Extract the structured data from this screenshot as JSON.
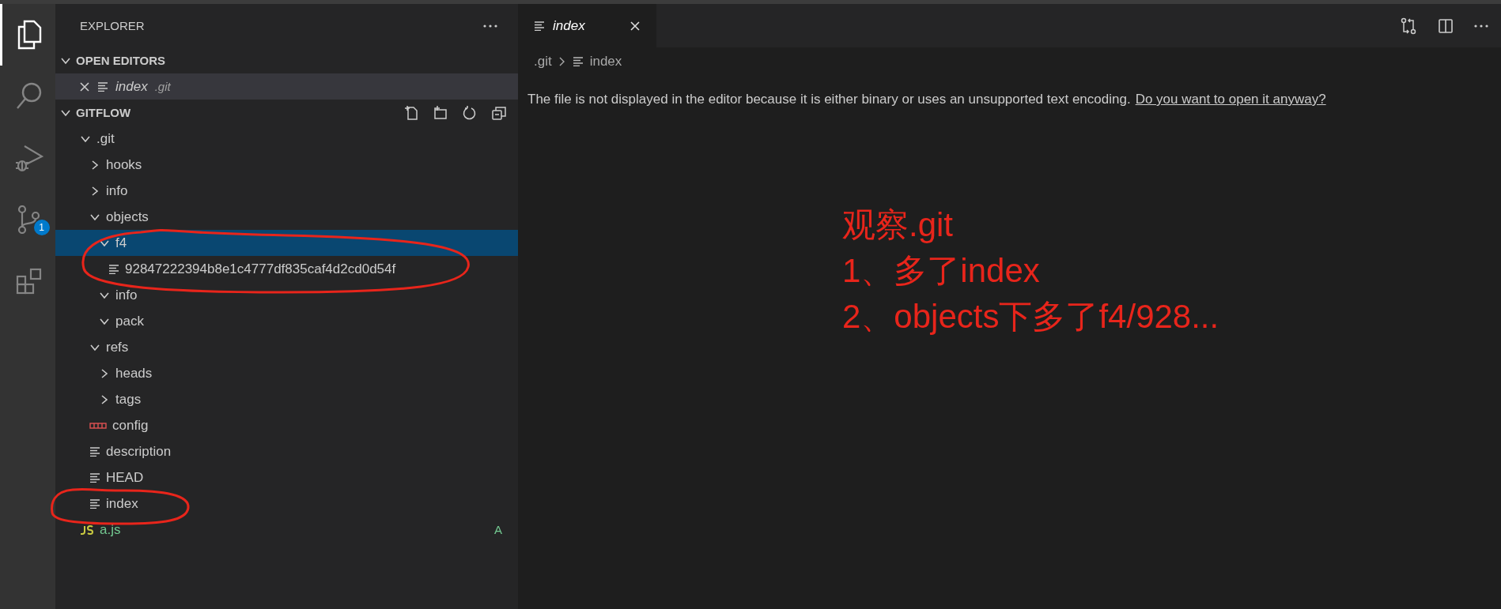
{
  "activity_bar": [
    {
      "kind": "explorer",
      "selected": true
    },
    {
      "kind": "search",
      "selected": false
    },
    {
      "kind": "debug",
      "selected": false
    },
    {
      "kind": "source_control",
      "selected": false,
      "badge": "1"
    },
    {
      "kind": "extensions",
      "selected": false
    }
  ],
  "sidebar": {
    "title": "EXPLORER",
    "open_editors": {
      "title": "OPEN EDITORS",
      "expanded": true,
      "items": [
        {
          "name": "index",
          "folder": ".git"
        }
      ]
    },
    "folder": {
      "title": "GITFLOW",
      "expanded": true,
      "tree": [
        {
          "name": ".git",
          "kind": "folder",
          "expanded": true,
          "selected": false,
          "children": [
            {
              "name": "hooks",
              "kind": "folder",
              "expanded": false,
              "selected": false
            },
            {
              "name": "info",
              "kind": "folder",
              "expanded": false,
              "selected": false
            },
            {
              "name": "objects",
              "kind": "folder",
              "expanded": true,
              "selected": false,
              "children": [
                {
                  "name": "f4",
                  "kind": "folder",
                  "expanded": true,
                  "selected": true,
                  "children": [
                    {
                      "name": "92847222394b8e1c4777df835caf4d2cd0d54f",
                      "kind": "file",
                      "selected": false
                    }
                  ]
                },
                {
                  "name": "info",
                  "kind": "folder",
                  "expanded": true,
                  "selected": false
                },
                {
                  "name": "pack",
                  "kind": "folder",
                  "expanded": true,
                  "selected": false
                }
              ]
            },
            {
              "name": "refs",
              "kind": "folder",
              "expanded": true,
              "selected": false,
              "children": [
                {
                  "name": "heads",
                  "kind": "folder",
                  "expanded": false,
                  "selected": false
                },
                {
                  "name": "tags",
                  "kind": "folder",
                  "expanded": false,
                  "selected": false
                }
              ]
            },
            {
              "name": "config",
              "kind": "config",
              "selected": false
            },
            {
              "name": "description",
              "kind": "file",
              "selected": false
            },
            {
              "name": "HEAD",
              "kind": "file",
              "selected": false
            },
            {
              "name": "index",
              "kind": "file",
              "selected": false
            }
          ]
        },
        {
          "name": "a.js",
          "kind": "js",
          "selected": false,
          "badge": "A"
        }
      ]
    }
  },
  "editor": {
    "tabs": [
      {
        "label": "index",
        "selected": true
      }
    ],
    "breadcrumbs": [
      ".git",
      "index"
    ],
    "message": "The file is not displayed in the editor because it is either binary or uses an unsupported text encoding.",
    "link": "Do you want to open it anyway?"
  },
  "annotation": {
    "lines": [
      "观察.git",
      "1、多了index",
      "2、objects下多了f4/928..."
    ]
  }
}
